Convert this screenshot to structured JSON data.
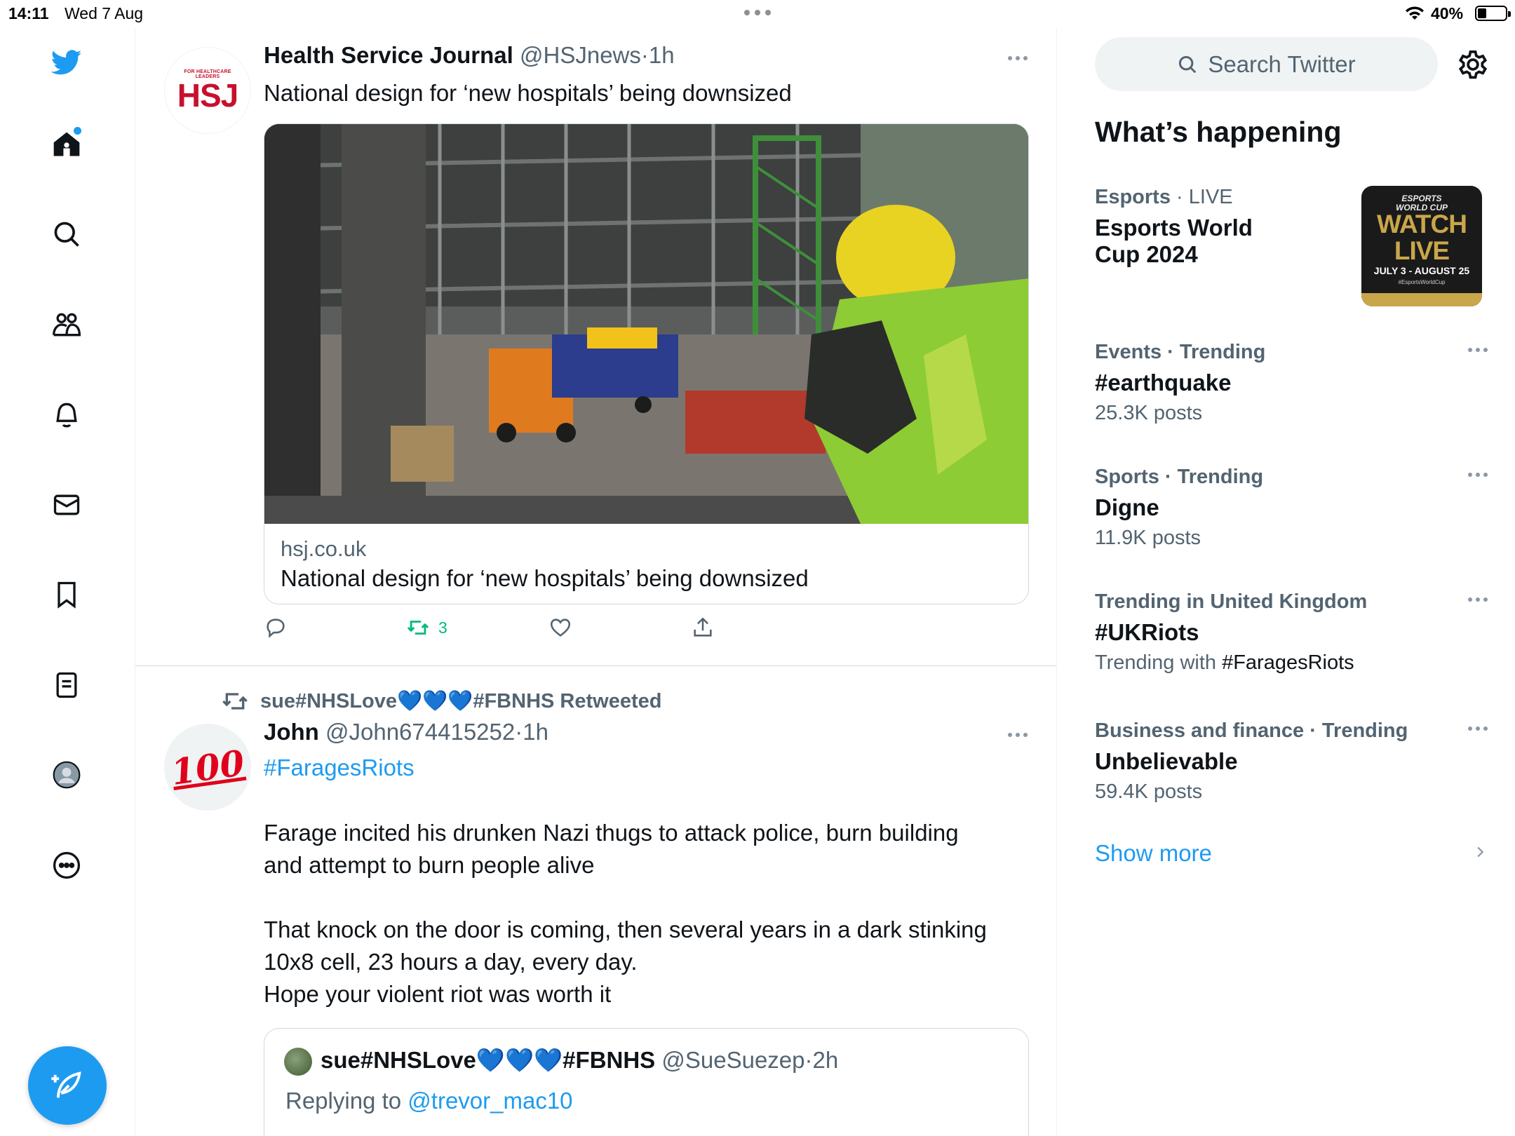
{
  "status_bar": {
    "time": "14:11",
    "date": "Wed 7 Aug",
    "battery": "40%"
  },
  "nav": {
    "items": [
      {
        "icon": "twitter-bird-icon"
      },
      {
        "icon": "home-icon"
      },
      {
        "icon": "search-icon"
      },
      {
        "icon": "communities-icon"
      },
      {
        "icon": "notifications-icon"
      },
      {
        "icon": "messages-icon"
      },
      {
        "icon": "bookmarks-icon"
      },
      {
        "icon": "lists-icon"
      },
      {
        "icon": "profile-icon"
      },
      {
        "icon": "more-icon"
      }
    ],
    "compose_icon": "compose-tweet-icon",
    "accent": "#1d9bf0"
  },
  "tweet1": {
    "avatar_text_small": "FOR HEALTHCARE LEADERS",
    "avatar_text": "HSJ",
    "name": "Health Service Journal",
    "handle": "@HSJnews",
    "sep": "·",
    "time": "1h",
    "text": "National design for ‘new hospitals’ being downsized",
    "card": {
      "domain": "hsj.co.uk",
      "title": "National design for ‘new hospitals’ being downsized"
    },
    "actions": {
      "reply_count": "",
      "retweet_count": "3",
      "like_count": ""
    }
  },
  "tweet2": {
    "retweeted_by": "sue#NHSLove💙💙💙#FBNHS Retweeted",
    "avatar_emoji": "100",
    "name": "John",
    "handle": "@John674415252",
    "sep": "·",
    "time": "1h",
    "hashtag": "#FaragesRiots",
    "para1_line1": "Farage incited his drunken Nazi thugs to attack police, burn building",
    "para1_line2": "and attempt to burn people alive",
    "para2_line1": "That knock on the door is coming, then several years in a dark stinking",
    "para2_line2": "10x8 cell, 23 hours a day, every day.",
    "para2_line3": "Hope your violent riot was worth it",
    "quote": {
      "name": "sue#NHSLove💙💙💙#FBNHS",
      "handle": "@SueSuezep",
      "sep": "·",
      "time": "2h",
      "replying_to": "Replying to",
      "mention": "@trevor_mac10"
    }
  },
  "sidebar": {
    "search_placeholder": "Search Twitter",
    "whats_happening": "What’s happening",
    "trends": [
      {
        "category": "Esports",
        "sep": " · ",
        "status": "LIVE",
        "title_line1": "Esports World",
        "title_line2": "Cup 2024"
      },
      {
        "context": "Events · Trending",
        "title": "#earthquake",
        "count": "25.3K posts"
      },
      {
        "context": "Sports · Trending",
        "title": "Digne",
        "count": "11.9K posts"
      },
      {
        "context": "Trending in United Kingdom",
        "title": "#UKRiots",
        "count_prefix": "Trending with ",
        "count_tag": "#FaragesRiots"
      },
      {
        "context": "Business and finance · Trending",
        "title": "Unbelievable",
        "count": "59.4K posts"
      }
    ],
    "esports_image": {
      "top_line1": "ESPORTS",
      "top_line2": "WORLD CUP",
      "watch": "WATCH",
      "live": "LIVE",
      "dates": "JULY 3 - AUGUST 25",
      "tag": "#EsportsWorldCup"
    },
    "show_more": "Show more"
  }
}
